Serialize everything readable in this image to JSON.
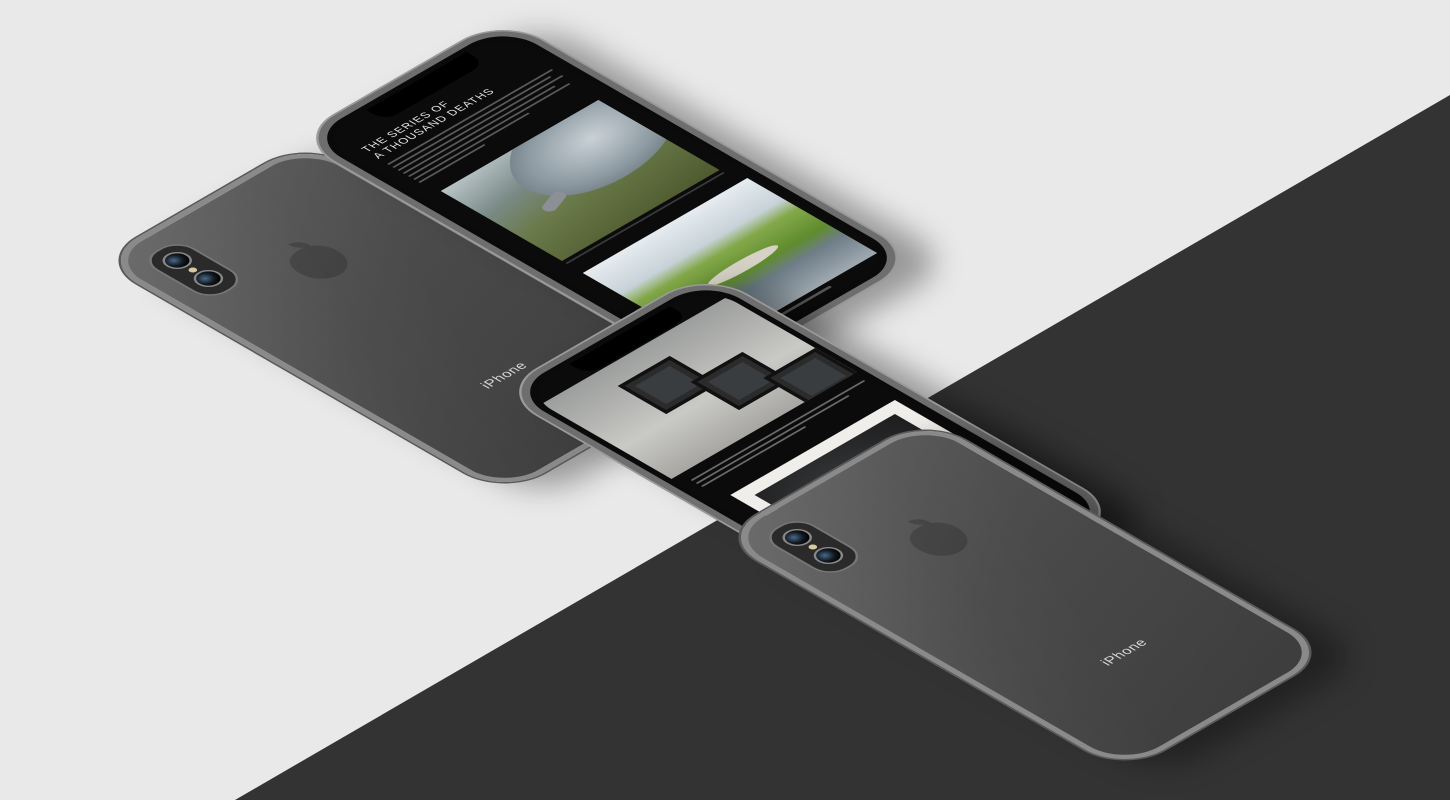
{
  "scene": {
    "background_light": "#e9e9e9",
    "background_dark": "#333333"
  },
  "devices": {
    "back_top_left": {
      "brand": "iPhone",
      "body_color": "#4a4a4a"
    },
    "back_bottom_right": {
      "brand": "iPhone",
      "body_color": "#4a4a4a"
    },
    "front_article": {
      "title": "THE SERIES OF\nA THOUSAND DEATHS",
      "icons": [
        "menu-icon"
      ]
    },
    "front_gallery": {
      "icons": [
        "menu-icon"
      ]
    }
  }
}
